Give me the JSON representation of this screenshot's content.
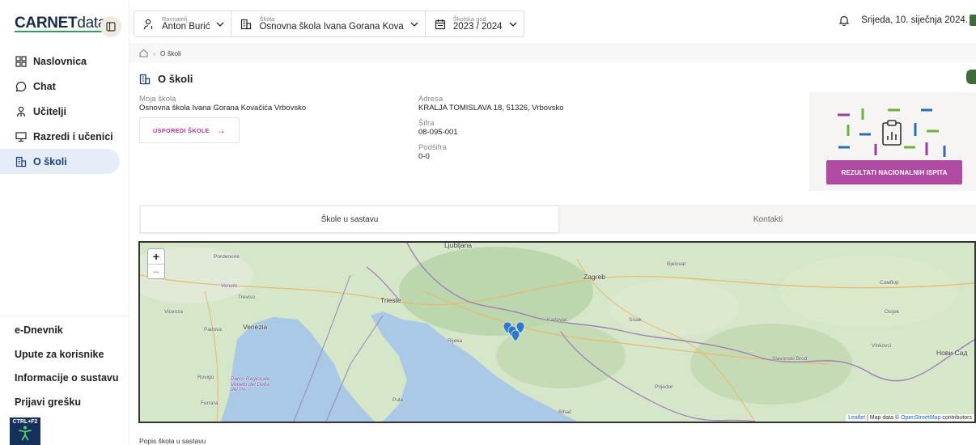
{
  "sidebar": {
    "brand_main": "CARNET",
    "brand_sub": "data",
    "items": [
      {
        "label": "Naslovnica",
        "icon": "dashboard-icon"
      },
      {
        "label": "Chat",
        "icon": "chat-icon"
      },
      {
        "label": "Učitelji",
        "icon": "teacher-icon"
      },
      {
        "label": "Razredi i učenici",
        "icon": "classroom-icon"
      },
      {
        "label": "O školi",
        "icon": "school-icon",
        "active": true
      }
    ],
    "footer_links": [
      "e-Dnevnik",
      "Upute za korisnike",
      "Informacije o sustavu",
      "Prijavi grešku"
    ],
    "a11y_label": "CTRL+F2"
  },
  "header": {
    "principal_label": "Ravnatelj",
    "principal_value": "Anton Burić",
    "school_label": "Škola",
    "school_value": "Osnovna škola Ivana Gorana Kova",
    "year_label": "Školska god.",
    "year_value": "2023 / 2024",
    "date": "Srijeda, 10. siječnja 2024."
  },
  "breadcrumb": {
    "current": "O školi"
  },
  "page": {
    "title": "O školi",
    "my_school_label": "Moja škola",
    "my_school_value": "Osnovna škola Ivana Gorana Kovačića Vrbovsko",
    "compare_button": "USPOREDI ŠKOLE",
    "address_label": "Adresa",
    "address_value": "KRALJA TOMISLAVA 18, 51326, Vrbovsko",
    "code_label": "Šifra",
    "code_value": "08-095-001",
    "subcode_label": "Podšifra",
    "subcode_value": "0-0",
    "results_button": "REZULTATI NACIONALNIH ISPITA"
  },
  "tabs": [
    {
      "label": "Škole u sastavu",
      "active": true
    },
    {
      "label": "Kontakti",
      "active": false
    }
  ],
  "map": {
    "zoom_in": "+",
    "zoom_out": "−",
    "attribution_leaflet": "Leaflet",
    "attribution_mid": " | Map data © ",
    "attribution_osm": "OpenStreetMap",
    "attribution_end": " contributors",
    "labels": {
      "ljubljana": "Ljubljana",
      "zagreb": "Zagreb",
      "trieste": "Trieste",
      "venezia": "Venezia",
      "rijeka": "Rijeka",
      "karlovac": "Karlovac",
      "sisak": "Sisak",
      "pordenone": "Pordenone",
      "treviso": "Treviso",
      "vicenza": "Vicenza",
      "padova": "Padova",
      "rovigo": "Rovigo",
      "ferrara": "Ferrara",
      "pula": "Pula",
      "bihac": "Bihać",
      "prijedor": "Prijedor",
      "slavonski_brod": "Slavonski Brod",
      "osijek": "Osijek",
      "vinkovci": "Vinkovci",
      "bjelovar": "Bjelovar",
      "novi_sad": "Нови Сад",
      "veneto": "Veneto",
      "po_delta": "Parco Regionale Veneto del Delta del Po",
      "sombor": "Сомбор"
    }
  },
  "list_title": "Popis škola u sastavu",
  "colors": {
    "accent": "#b04aa3",
    "nav_active_bg": "#e4edf8",
    "brand": "#1b2b44",
    "sea": "#a9c9e7",
    "land": "#cfe0c3"
  }
}
